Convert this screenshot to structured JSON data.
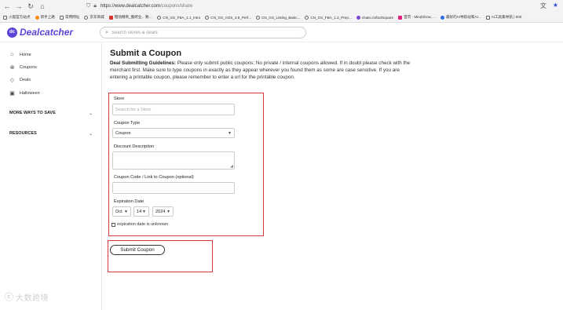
{
  "browser": {
    "url_host": "https://www.dealcatcher.com",
    "url_path": "/coupons/share"
  },
  "bookmarks": [
    {
      "label": "火狐官方站点",
      "icon": "folder-icon"
    },
    {
      "label": "新手上路",
      "icon": "firefox-icon"
    },
    {
      "label": "常用网址",
      "icon": "folder-icon"
    },
    {
      "label": "京东商城",
      "icon": "globe-icon"
    },
    {
      "label": "粗动精英_搬砖业、数…",
      "icon": "red-square-icon"
    },
    {
      "label": "CN_GS_FBA_1.1_Intro",
      "icon": "globe-icon"
    },
    {
      "label": "CN_GS_AGS_3.8_Perf...",
      "icon": "globe-icon"
    },
    {
      "label": "CN_GS_Listing_Basic...",
      "icon": "globe-icon"
    },
    {
      "label": "CN_GS_FBA_1.2_Prep...",
      "icon": "globe-icon"
    },
    {
      "label": "chato.cn/bot/square",
      "icon": "purple-circle-icon"
    },
    {
      "label": "首页 - MindShow, ...",
      "icon": "pink-square-icon"
    },
    {
      "label": "最好的AI导航站和AI...",
      "icon": "blue-circle-icon"
    },
    {
      "label": "AI工具集导航 | 500",
      "icon": "ai-icon"
    }
  ],
  "header": {
    "logo_mark": "dc",
    "logo_text": "Dealcatcher",
    "search_placeholder": "Search stores & deals"
  },
  "sidebar": {
    "items": [
      {
        "label": "Home",
        "icon": "home-icon"
      },
      {
        "label": "Coupons",
        "icon": "coupon-icon"
      },
      {
        "label": "Deals",
        "icon": "tag-icon"
      },
      {
        "label": "Halloween",
        "icon": "calendar-icon"
      }
    ],
    "sections": [
      {
        "label": "MORE WAYS TO SAVE"
      },
      {
        "label": "RESOURCES"
      }
    ]
  },
  "main": {
    "title": "Submit a Coupon",
    "guidelines_lead": "Deal Submitting Guidelines:",
    "guidelines_body": " Please only submit public coupons; No private / internal coupons allowed. If in doubt please check with the merchant first. Make sure to type coupons in exactly as they appear wherever you found them as some are case sensitive. If you are entering a printable coupon, please remember to enter a url for the printable coupon."
  },
  "form": {
    "store_label": "Store",
    "store_placeholder": "Search for a Store",
    "store_value": "",
    "coupon_type_label": "Coupon Type",
    "coupon_type_value": "Coupon",
    "discount_label": "Discount Description",
    "discount_value": "",
    "code_label": "Coupon Code / Link to Coupon (optional)",
    "code_value": "",
    "expiration_label": "Expiration Date",
    "exp_month": "Oct",
    "exp_day": "14",
    "exp_year": "2024",
    "unknown_label": "expiration date is unknown",
    "unknown_checked": false,
    "submit_label": "Submit Coupon"
  },
  "watermark": {
    "text": "大数跨境"
  },
  "colors": {
    "brand": "#5b44d6",
    "annotation_red": "#d63a3a"
  }
}
